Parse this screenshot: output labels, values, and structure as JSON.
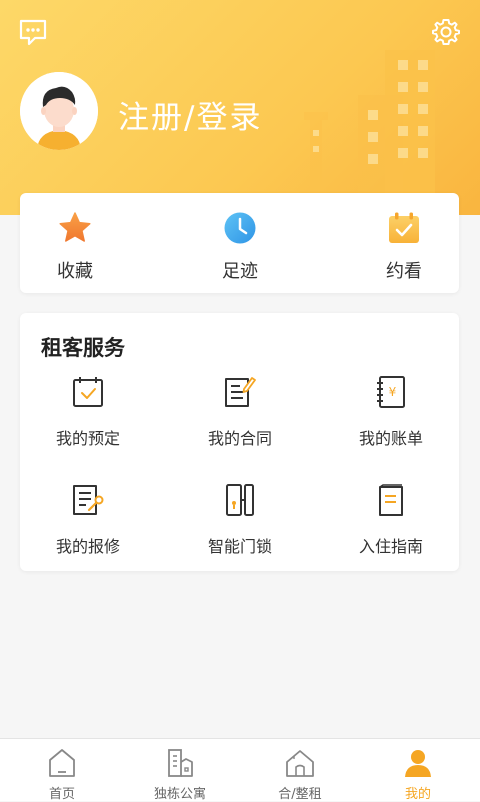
{
  "header": {
    "login_label": "注册/登录"
  },
  "quick_actions": [
    {
      "label": "收藏",
      "icon": "star-icon"
    },
    {
      "label": "足迹",
      "icon": "clock-icon"
    },
    {
      "label": "约看",
      "icon": "calendar-check-icon"
    }
  ],
  "services": {
    "title": "租客服务",
    "items": [
      {
        "label": "我的预定",
        "icon": "calendar-check-icon"
      },
      {
        "label": "我的合同",
        "icon": "contract-edit-icon"
      },
      {
        "label": "我的账单",
        "icon": "bill-notebook-icon"
      },
      {
        "label": "我的报修",
        "icon": "repair-document-icon"
      },
      {
        "label": "智能门锁",
        "icon": "smart-lock-icon"
      },
      {
        "label": "入住指南",
        "icon": "guide-book-icon"
      }
    ]
  },
  "tabbar": {
    "items": [
      {
        "label": "首页",
        "icon": "home-icon",
        "active": false
      },
      {
        "label": "独栋公寓",
        "icon": "building-icon",
        "active": false
      },
      {
        "label": "合/整租",
        "icon": "house-icon",
        "active": false
      },
      {
        "label": "我的",
        "icon": "user-icon",
        "active": true
      }
    ]
  },
  "colors": {
    "accent": "#f5a623",
    "header_start": "#fdd868",
    "header_end": "#f9b53f"
  }
}
